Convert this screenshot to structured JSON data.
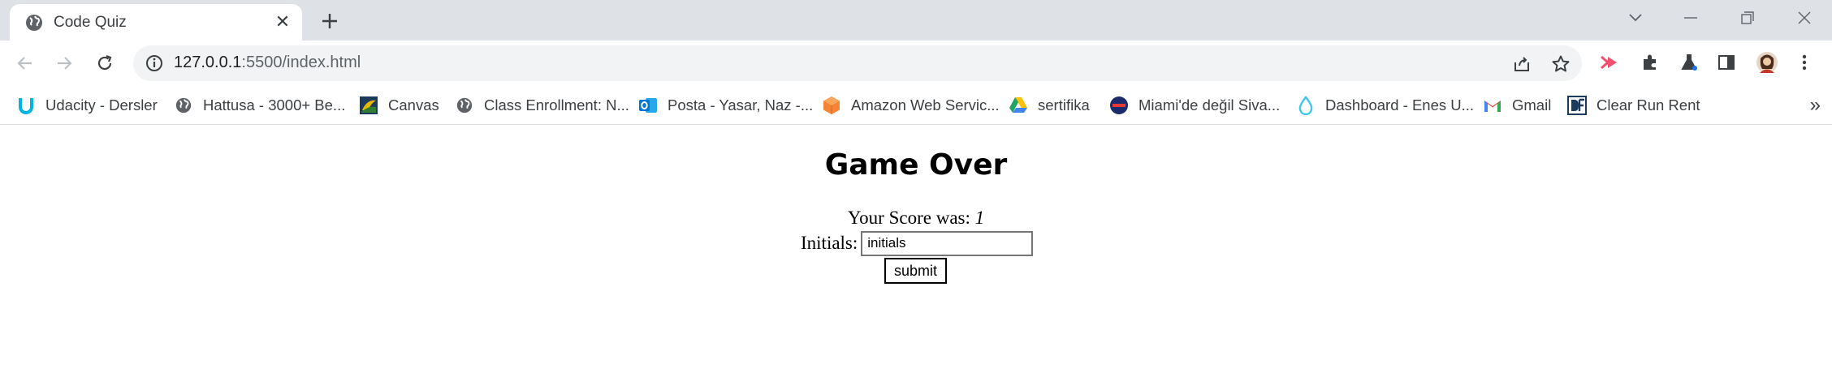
{
  "browser": {
    "tab": {
      "title": "Code Quiz",
      "favicon": "globe-icon"
    },
    "address": {
      "host": "127.0.0.1",
      "path": ":5500/index.html"
    },
    "bookmarks": [
      {
        "label": "Udacity - Dersler",
        "icon": "udacity-icon",
        "color": "#02b3e4"
      },
      {
        "label": "Hattusa - 3000+ Be...",
        "icon": "globe-icon",
        "color": "#5f6368"
      },
      {
        "label": "Canvas",
        "icon": "canvas-icon",
        "color": "#e66000"
      },
      {
        "label": "Class Enrollment: N...",
        "icon": "globe-icon",
        "color": "#5f6368"
      },
      {
        "label": "Posta - Yasar, Naz -...",
        "icon": "outlook-icon",
        "color": "#0078d4"
      },
      {
        "label": "Amazon Web Servic...",
        "icon": "aws-icon",
        "color": "#f58536"
      },
      {
        "label": "sertifika",
        "icon": "google-drive-icon",
        "color": "#1fa463"
      },
      {
        "label": "Miami'de değil Siva...",
        "icon": "circle-logo-icon",
        "color": "#1a2a6c"
      },
      {
        "label": "Dashboard - Enes U...",
        "icon": "drop-icon",
        "color": "#3cc8e6"
      },
      {
        "label": "Gmail",
        "icon": "gmail-icon",
        "color": "#ea4335"
      },
      {
        "label": "Clear Run Rent",
        "icon": "df-logo-icon",
        "color": "#1b3a5c"
      }
    ]
  },
  "page": {
    "heading": "Game Over",
    "score_label": "Your Score was:",
    "score_value": "1",
    "initials_label": "Initials:",
    "initials_value": "initials",
    "submit_label": "submit"
  }
}
